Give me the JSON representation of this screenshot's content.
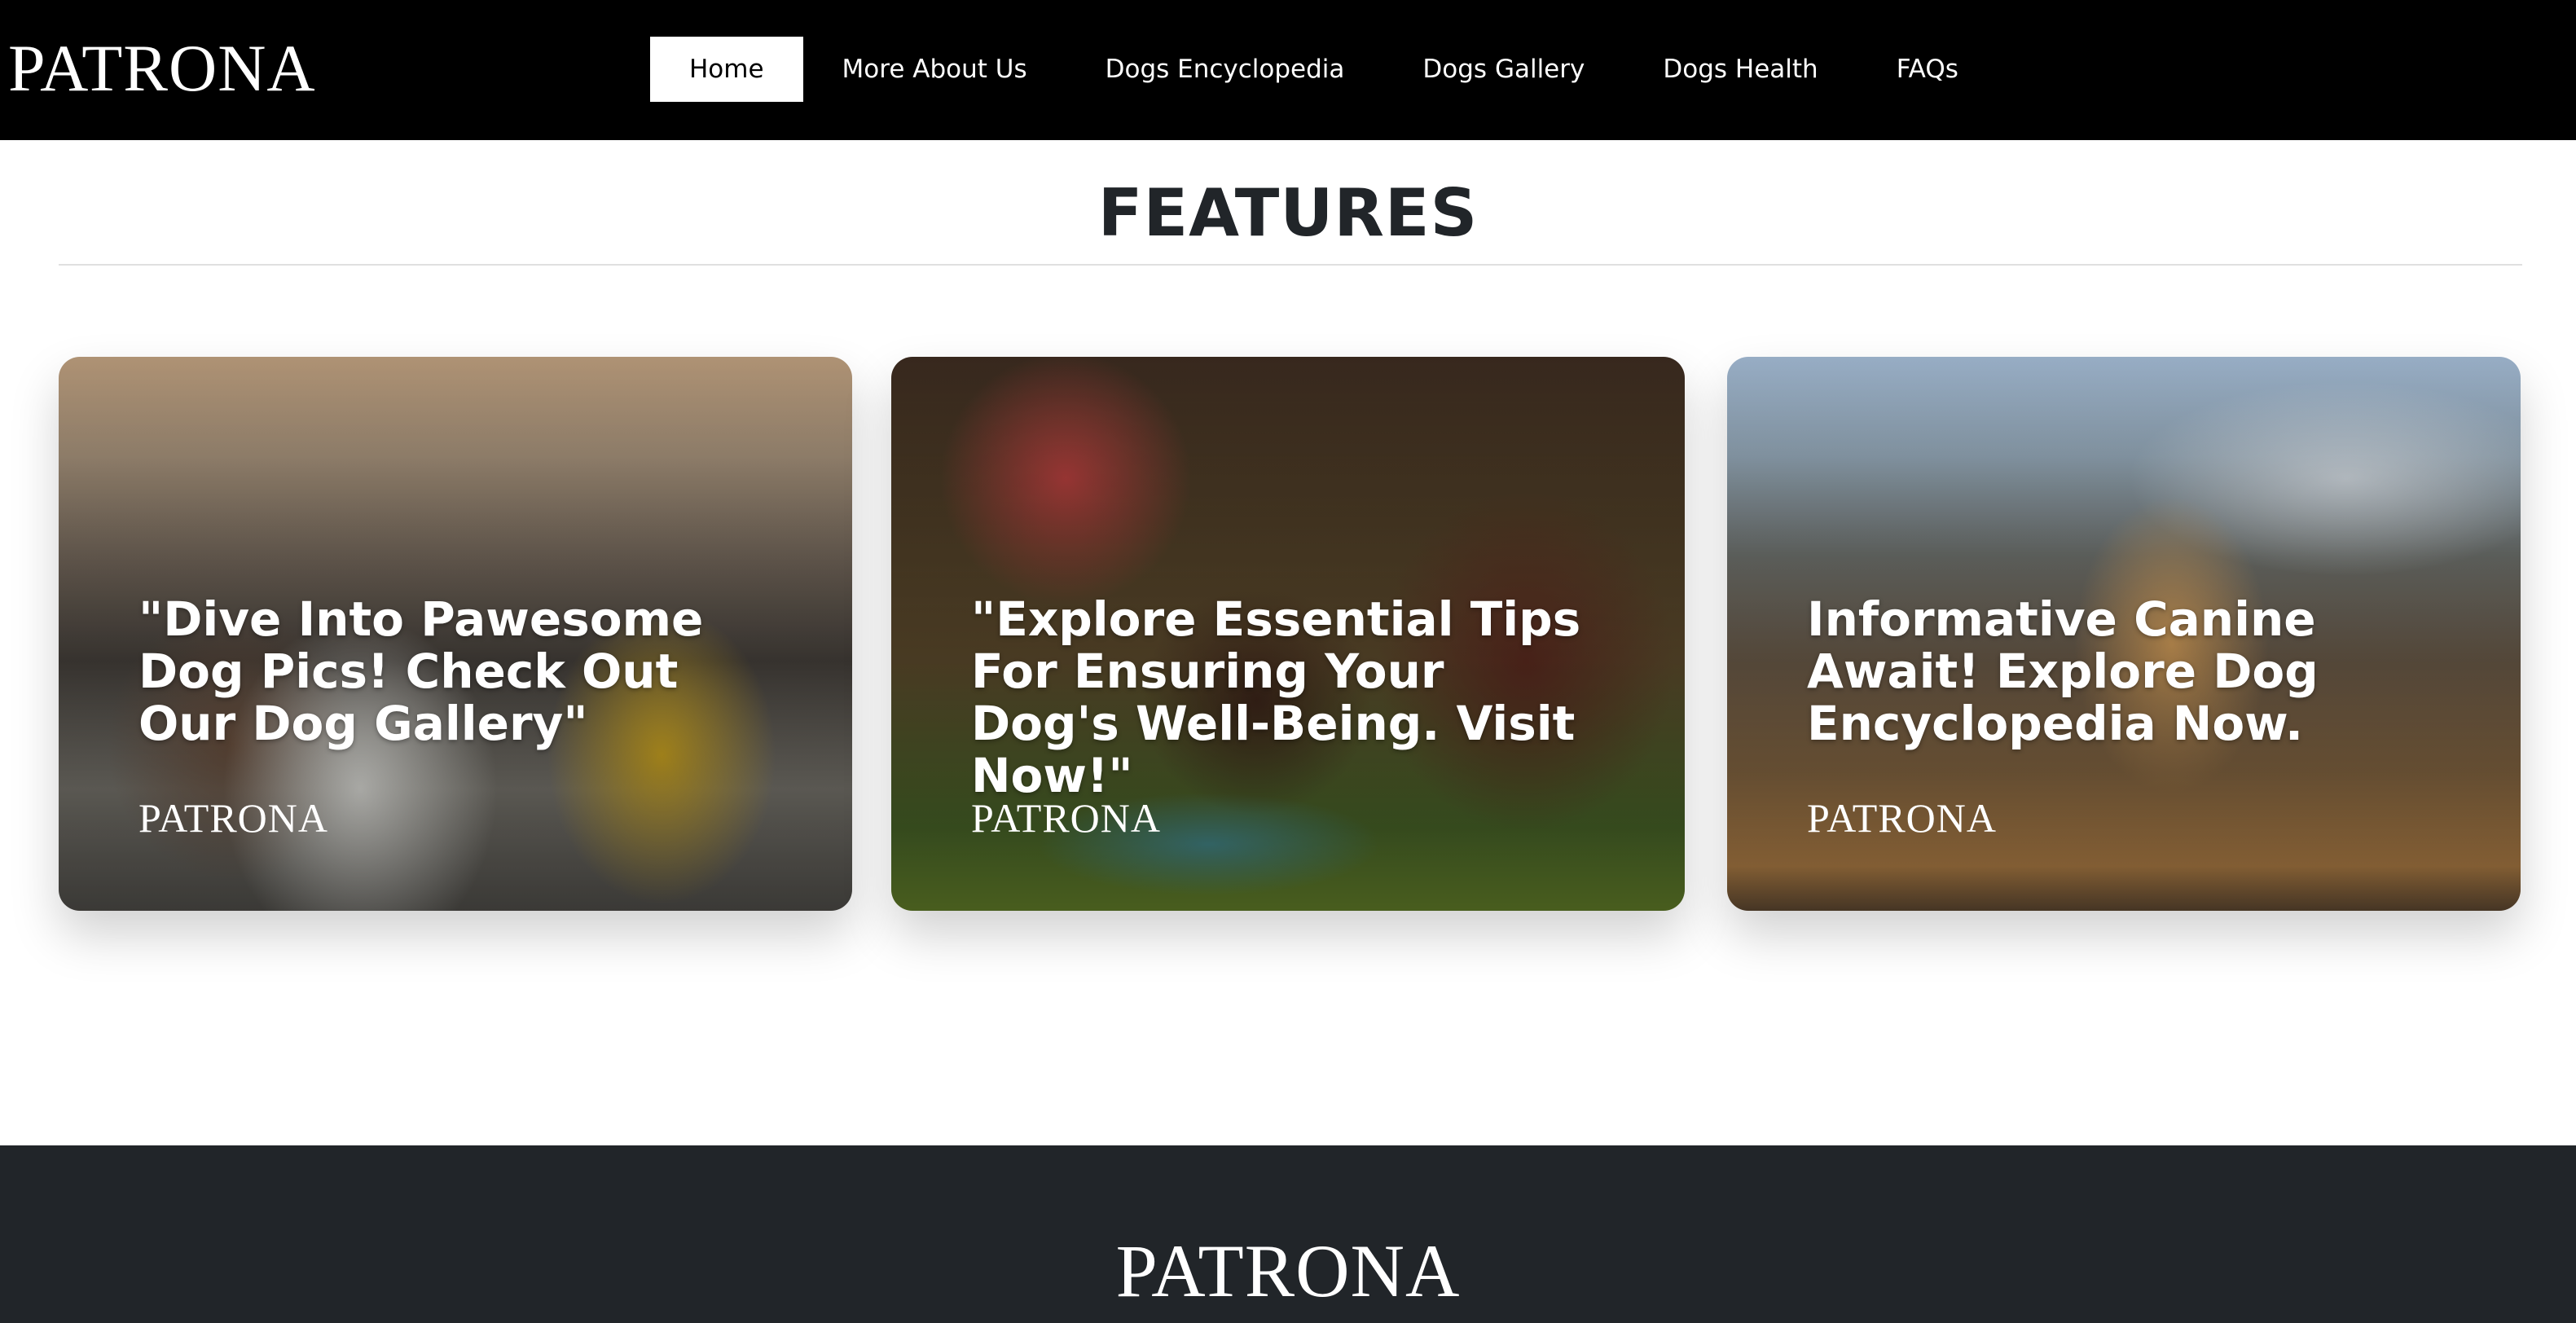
{
  "navbar": {
    "brand": "PATRONA",
    "items": [
      {
        "label": "Home",
        "active": true
      },
      {
        "label": "More About Us",
        "active": false
      },
      {
        "label": "Dogs Encyclopedia",
        "active": false
      },
      {
        "label": "Dogs Gallery",
        "active": false
      },
      {
        "label": "Dogs Health",
        "active": false
      },
      {
        "label": "FAQs",
        "active": false
      }
    ]
  },
  "features": {
    "title": "FEATURES",
    "cards": [
      {
        "title": "\"Dive Into Pawesome Dog Pics! Check Out Our Dog Gallery\"",
        "logo": "PATRONA"
      },
      {
        "title": "\"Explore Essential Tips For Ensuring Your Dog's Well-Being. Visit Now!\"",
        "logo": "PATRONA"
      },
      {
        "title": "Informative Canine Await! Explore Dog Encyclopedia Now.",
        "logo": "PATRONA"
      }
    ]
  },
  "footer": {
    "brand": "PATRONA"
  },
  "colors": {
    "navbar_bg": "#000000",
    "footer_bg": "#212529",
    "active_nav_bg": "#ffffff",
    "text_dark": "#212529"
  }
}
